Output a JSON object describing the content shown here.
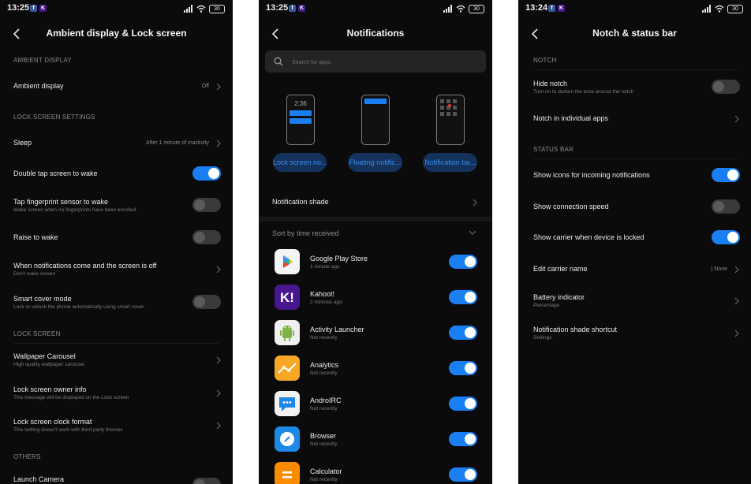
{
  "colors": {
    "accent": "#1a7ff2",
    "background": "#0b0b0b",
    "toggle_off": "#3a3a3a"
  },
  "screens": [
    {
      "status": {
        "time": "13:25",
        "battery": "30"
      },
      "title": "Ambient display & Lock screen",
      "sections": {
        "ambient": "AMBIENT DISPLAY",
        "lock_settings": "LOCK SCREEN SETTINGS",
        "lock_screen": "LOCK SCREEN",
        "others": "OTHERS"
      },
      "rows": {
        "ambient_display": {
          "label": "Ambient display",
          "value": "Off"
        },
        "sleep": {
          "label": "Sleep",
          "value": "After 1 minute of inactivity"
        },
        "double_tap": {
          "label": "Double tap screen to wake",
          "on": true
        },
        "fingerprint": {
          "label": "Tap fingerprint sensor to wake",
          "sub": "Wake screen when no fingerprints have been enrolled.",
          "on": false
        },
        "raise": {
          "label": "Raise to wake",
          "on": false
        },
        "notifications": {
          "label": "When notifications come and the screen is off",
          "sub": "Don't wake screen"
        },
        "smart_cover": {
          "label": "Smart cover mode",
          "sub": "Lock or unlock the phone automatically using smart cover",
          "on": false
        },
        "wallpaper": {
          "label": "Wallpaper Carousel",
          "sub": "High quality wallpaper carousel"
        },
        "owner_info": {
          "label": "Lock screen owner info",
          "sub": "This message will be displayed on the Lock screen"
        },
        "clock_format": {
          "label": "Lock screen clock format",
          "sub": "This setting doesn't work with third party themes"
        },
        "launch_camera": {
          "label": "Launch Camera"
        }
      }
    },
    {
      "status": {
        "time": "13:25",
        "battery": "30"
      },
      "title": "Notifications",
      "search_placeholder": "Search for apps",
      "mockups": {
        "mock1_time": "2:36"
      },
      "pills": [
        "Lock screen no...",
        "Floating notific...",
        "Notification ba..."
      ],
      "notification_shade": "Notification shade",
      "sort_label": "Sort by time received",
      "apps": [
        {
          "name": "Google Play Store",
          "time": "1 minute ago",
          "on": true
        },
        {
          "name": "Kahoot!",
          "time": "2 minutes ago",
          "on": true
        },
        {
          "name": "Activity Launcher",
          "time": "Not recently",
          "on": true
        },
        {
          "name": "Analytics",
          "time": "Not recently",
          "on": true
        },
        {
          "name": "AndroIRC",
          "time": "Not recently",
          "on": true
        },
        {
          "name": "Browser",
          "time": "Not recently",
          "on": true
        },
        {
          "name": "Calculator",
          "time": "Not recently",
          "on": true
        }
      ],
      "app_icon_text": {
        "kahoot": "K!"
      }
    },
    {
      "status": {
        "time": "13:24",
        "battery": "30"
      },
      "title": "Notch & status bar",
      "sections": {
        "notch": "NOTCH",
        "status_bar": "STATUS BAR"
      },
      "rows": {
        "hide_notch": {
          "label": "Hide notch",
          "sub": "Turn on to darken the area around the notch",
          "on": false
        },
        "notch_apps": {
          "label": "Notch in individual apps"
        },
        "show_icons": {
          "label": "Show icons for incoming notifications",
          "on": true
        },
        "conn_speed": {
          "label": "Show connection speed",
          "on": false
        },
        "carrier_locked": {
          "label": "Show carrier when device is locked",
          "on": true
        },
        "carrier_name": {
          "label": "Edit carrier name",
          "value": "| None"
        },
        "battery_ind": {
          "label": "Battery indicator",
          "sub": "Percentage"
        },
        "shade_shortcut": {
          "label": "Notification shade shortcut",
          "sub": "Settings"
        }
      }
    }
  ]
}
